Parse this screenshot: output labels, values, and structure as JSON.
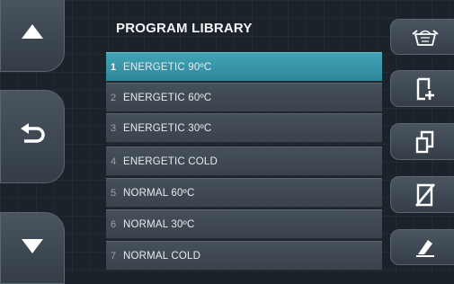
{
  "screen": {
    "title": "PROGRAM LIBRARY"
  },
  "navigation": {
    "up_icon": "triangle-up-icon",
    "back_icon": "return-arrow-icon",
    "down_icon": "triangle-down-icon"
  },
  "programs": [
    {
      "number": "1",
      "name": "ENERGETIC 90ºC",
      "selected": true
    },
    {
      "number": "2",
      "name": "ENERGETIC 60ºC",
      "selected": false
    },
    {
      "number": "3",
      "name": "ENERGETIC 30ºC",
      "selected": false
    },
    {
      "number": "4",
      "name": "ENERGETIC COLD",
      "selected": false
    },
    {
      "number": "5",
      "name": "NORMAL 60ºC",
      "selected": false
    },
    {
      "number": "6",
      "name": "NORMAL 30ºC",
      "selected": false
    },
    {
      "number": "7",
      "name": "NORMAL COLD",
      "selected": false
    }
  ],
  "actions": [
    {
      "icon": "laundry-basket-icon"
    },
    {
      "icon": "new-document-icon"
    },
    {
      "icon": "copy-icon"
    },
    {
      "icon": "delete-icon"
    },
    {
      "icon": "edit-icon"
    }
  ],
  "colors": {
    "background": "#1c2229",
    "selected_row": "#3596a8",
    "row": "#3f4851",
    "text": "#e8ebee"
  }
}
